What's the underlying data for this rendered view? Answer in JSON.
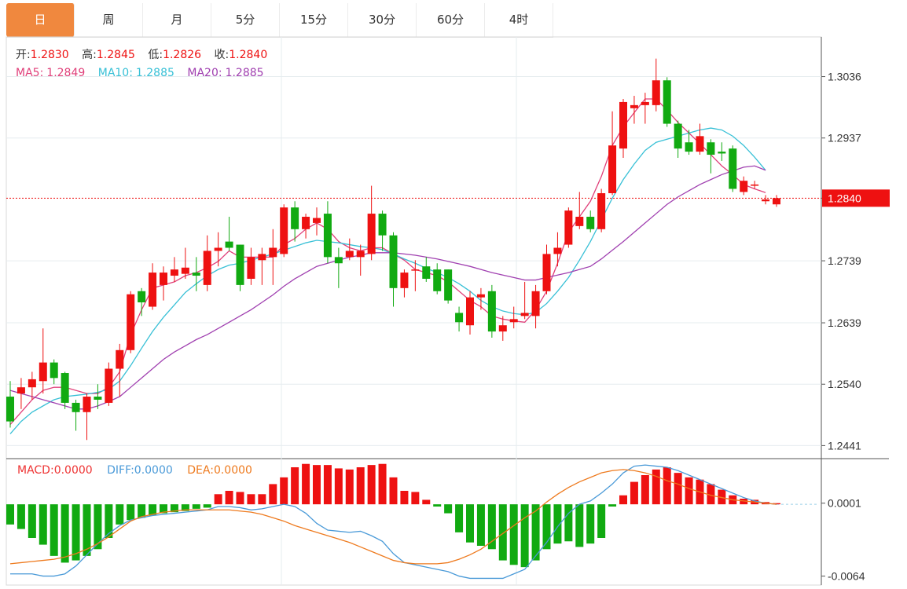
{
  "tabs": [
    {
      "label": "日",
      "active": true
    },
    {
      "label": "周",
      "active": false
    },
    {
      "label": "月",
      "active": false
    },
    {
      "label": "5分",
      "active": false
    },
    {
      "label": "15分",
      "active": false
    },
    {
      "label": "30分",
      "active": false
    },
    {
      "label": "60分",
      "active": false
    },
    {
      "label": "4时",
      "active": false
    }
  ],
  "ohlc_header": {
    "open_label": "开:",
    "open": "1.2830",
    "high_label": "高:",
    "high": "1.2845",
    "low_label": "低:",
    "low": "1.2826",
    "close_label": "收:",
    "close": "1.2840"
  },
  "ma_header": {
    "ma5_label": "MA5:",
    "ma5": "1.2849",
    "ma10_label": "MA10:",
    "ma10": "1.2885",
    "ma20_label": "MA20:",
    "ma20": "1.2885"
  },
  "macd_header": {
    "macd_label": "MACD:",
    "macd": "0.0000",
    "diff_label": "DIFF:",
    "diff": "0.0000",
    "dea_label": "DEA:",
    "dea": "0.0000"
  },
  "colors": {
    "up": "#ee1111",
    "down": "#11aa11",
    "ma5": "#e0407a",
    "ma10": "#38c0d6",
    "ma20": "#a040b0",
    "diff": "#4a9ad8",
    "dea": "#ee7a1e",
    "last": "#ee1111"
  },
  "chart_data": [
    {
      "type": "candlestick",
      "ylim": [
        1.242,
        1.31
      ],
      "yticks": [
        "1.3036",
        "1.2937",
        "1.2840",
        "1.2739",
        "1.2639",
        "1.2540",
        "1.2441"
      ],
      "last_price": "1.2840",
      "candles": [
        [
          1.252,
          1.248,
          1.2545,
          1.247
        ],
        [
          1.2525,
          1.2535,
          1.255,
          1.25
        ],
        [
          1.2535,
          1.2548,
          1.256,
          1.2515
        ],
        [
          1.2545,
          1.2575,
          1.263,
          1.2525
        ],
        [
          1.2575,
          1.255,
          1.258,
          1.254
        ],
        [
          1.2558,
          1.251,
          1.256,
          1.25
        ],
        [
          1.251,
          1.2495,
          1.2515,
          1.2465
        ],
        [
          1.2495,
          1.252,
          1.2525,
          1.245
        ],
        [
          1.252,
          1.2515,
          1.254,
          1.25
        ],
        [
          1.251,
          1.2565,
          1.2575,
          1.2505
        ],
        [
          1.2565,
          1.2595,
          1.2605,
          1.252
        ],
        [
          1.2595,
          1.2685,
          1.269,
          1.259
        ],
        [
          1.269,
          1.2672,
          1.2695,
          1.265
        ],
        [
          1.2665,
          1.272,
          1.2735,
          1.266
        ],
        [
          1.27,
          1.272,
          1.273,
          1.2675
        ],
        [
          1.2715,
          1.2725,
          1.2745,
          1.2705
        ],
        [
          1.2718,
          1.2728,
          1.276,
          1.271
        ],
        [
          1.272,
          1.2715,
          1.2745,
          1.269
        ],
        [
          1.27,
          1.2755,
          1.278,
          1.269
        ],
        [
          1.2755,
          1.276,
          1.2785,
          1.273
        ],
        [
          1.277,
          1.276,
          1.281,
          1.2755
        ],
        [
          1.2765,
          1.27,
          1.2765,
          1.269
        ],
        [
          1.271,
          1.2745,
          1.276,
          1.27
        ],
        [
          1.274,
          1.275,
          1.276,
          1.27
        ],
        [
          1.2745,
          1.276,
          1.279,
          1.27
        ],
        [
          1.275,
          1.2825,
          1.283,
          1.2745
        ],
        [
          1.2825,
          1.279,
          1.2835,
          1.277
        ],
        [
          1.279,
          1.281,
          1.2815,
          1.2775
        ],
        [
          1.28,
          1.2808,
          1.2825,
          1.278
        ],
        [
          1.2815,
          1.2745,
          1.2835,
          1.2735
        ],
        [
          1.2745,
          1.2735,
          1.276,
          1.2695
        ],
        [
          1.2745,
          1.2755,
          1.2775,
          1.274
        ],
        [
          1.2745,
          1.2755,
          1.2765,
          1.2715
        ],
        [
          1.275,
          1.2815,
          1.286,
          1.274
        ],
        [
          1.2815,
          1.278,
          1.282,
          1.2755
        ],
        [
          1.278,
          1.2695,
          1.2785,
          1.2665
        ],
        [
          1.2695,
          1.272,
          1.2725,
          1.268
        ],
        [
          1.2725,
          1.2725,
          1.274,
          1.269
        ],
        [
          1.273,
          1.271,
          1.2745,
          1.2705
        ],
        [
          1.2725,
          1.269,
          1.2735,
          1.2685
        ],
        [
          1.2725,
          1.2675,
          1.2725,
          1.267
        ],
        [
          1.2655,
          1.264,
          1.2665,
          1.2625
        ],
        [
          1.2635,
          1.268,
          1.269,
          1.262
        ],
        [
          1.268,
          1.2685,
          1.2695,
          1.266
        ],
        [
          1.269,
          1.2625,
          1.27,
          1.2615
        ],
        [
          1.2625,
          1.2635,
          1.265,
          1.261
        ],
        [
          1.264,
          1.2645,
          1.2665,
          1.263
        ],
        [
          1.265,
          1.2655,
          1.2705,
          1.2645
        ],
        [
          1.265,
          1.269,
          1.27,
          1.263
        ],
        [
          1.269,
          1.275,
          1.2765,
          1.2685
        ],
        [
          1.275,
          1.276,
          1.2785,
          1.273
        ],
        [
          1.2765,
          1.282,
          1.2825,
          1.276
        ],
        [
          1.2795,
          1.281,
          1.285,
          1.279
        ],
        [
          1.281,
          1.279,
          1.282,
          1.2785
        ],
        [
          1.279,
          1.2848,
          1.2855,
          1.2785
        ],
        [
          1.2848,
          1.2925,
          1.298,
          1.2845
        ],
        [
          1.292,
          1.2995,
          1.3,
          1.2905
        ],
        [
          1.2985,
          1.299,
          1.3005,
          1.296
        ],
        [
          1.299,
          1.2995,
          1.301,
          1.296
        ],
        [
          1.299,
          1.303,
          1.3065,
          1.298
        ],
        [
          1.303,
          1.296,
          1.3035,
          1.2955
        ],
        [
          1.296,
          1.292,
          1.2965,
          1.2905
        ],
        [
          1.293,
          1.2915,
          1.295,
          1.291
        ],
        [
          1.2915,
          1.294,
          1.296,
          1.291
        ],
        [
          1.293,
          1.291,
          1.2935,
          1.288
        ],
        [
          1.2915,
          1.2912,
          1.293,
          1.29
        ],
        [
          1.292,
          1.2855,
          1.2925,
          1.285
        ],
        [
          1.285,
          1.2868,
          1.2875,
          1.2845
        ],
        [
          1.286,
          1.2862,
          1.2868,
          1.2855
        ],
        [
          1.2835,
          1.2838,
          1.2845,
          1.283
        ],
        [
          1.283,
          1.284,
          1.2845,
          1.2826
        ]
      ],
      "ma5": [
        1.2475,
        1.2495,
        1.2515,
        1.253,
        1.2535,
        1.2535,
        1.253,
        1.2525,
        1.2525,
        1.2535,
        1.256,
        1.262,
        1.266,
        1.2695,
        1.27,
        1.2705,
        1.2715,
        1.272,
        1.2728,
        1.2738,
        1.2755,
        1.2745,
        1.2745,
        1.2745,
        1.2745,
        1.2765,
        1.2775,
        1.279,
        1.28,
        1.279,
        1.277,
        1.276,
        1.2755,
        1.276,
        1.276,
        1.275,
        1.274,
        1.2725,
        1.272,
        1.2715,
        1.2705,
        1.269,
        1.2675,
        1.2665,
        1.265,
        1.2645,
        1.2642,
        1.264,
        1.266,
        1.269,
        1.2735,
        1.2785,
        1.281,
        1.2835,
        1.2875,
        1.2925,
        1.2955,
        1.2978,
        1.3,
        1.3,
        1.2982,
        1.2962,
        1.2945,
        1.2928,
        1.291,
        1.2892,
        1.2878,
        1.2862,
        1.2855,
        1.2849
      ],
      "ma10": [
        1.246,
        1.248,
        1.2495,
        1.2505,
        1.2515,
        1.252,
        1.2522,
        1.2524,
        1.2527,
        1.2532,
        1.2545,
        1.257,
        1.2598,
        1.2625,
        1.2648,
        1.2668,
        1.2688,
        1.2702,
        1.2715,
        1.2725,
        1.2732,
        1.2735,
        1.274,
        1.2745,
        1.275,
        1.2756,
        1.2762,
        1.2768,
        1.2772,
        1.277,
        1.2768,
        1.2765,
        1.2762,
        1.276,
        1.2757,
        1.275,
        1.2742,
        1.2735,
        1.2727,
        1.272,
        1.2712,
        1.2702,
        1.269,
        1.2675,
        1.2665,
        1.2658,
        1.2654,
        1.2652,
        1.2656,
        1.267,
        1.269,
        1.2712,
        1.274,
        1.277,
        1.2805,
        1.284,
        1.287,
        1.2895,
        1.2917,
        1.293,
        1.2935,
        1.294,
        1.2945,
        1.295,
        1.2953,
        1.295,
        1.294,
        1.2925,
        1.2906,
        1.2885
      ],
      "ma20": [
        1.253,
        1.2525,
        1.252,
        1.2515,
        1.251,
        1.2505,
        1.25,
        1.25,
        1.2505,
        1.2512,
        1.252,
        1.2535,
        1.255,
        1.2565,
        1.258,
        1.2592,
        1.2602,
        1.2612,
        1.262,
        1.263,
        1.264,
        1.265,
        1.266,
        1.2672,
        1.2684,
        1.2698,
        1.271,
        1.272,
        1.273,
        1.2735,
        1.274,
        1.2745,
        1.2748,
        1.2752,
        1.2752,
        1.2752,
        1.275,
        1.2748,
        1.2745,
        1.2742,
        1.2738,
        1.2734,
        1.273,
        1.2725,
        1.272,
        1.2716,
        1.2712,
        1.2708,
        1.2708,
        1.2712,
        1.2716,
        1.272,
        1.2725,
        1.273,
        1.2742,
        1.2756,
        1.277,
        1.2785,
        1.28,
        1.2815,
        1.283,
        1.2842,
        1.2852,
        1.2862,
        1.287,
        1.2878,
        1.2884,
        1.289,
        1.2892,
        1.2885
      ]
    },
    {
      "type": "bar",
      "name": "MACD",
      "ylim": [
        -0.0072,
        0.004
      ],
      "yticks": [
        "0.0001",
        "-0.0064"
      ],
      "macd": [
        -0.0018,
        -0.0022,
        -0.003,
        -0.0036,
        -0.0046,
        -0.0052,
        -0.005,
        -0.0046,
        -0.004,
        -0.003,
        -0.0018,
        -0.0014,
        -0.0012,
        -0.001,
        -0.0008,
        -0.0007,
        -0.0006,
        -0.0004,
        -0.0003,
        0.0009,
        0.0012,
        0.0011,
        0.0009,
        0.0009,
        0.0018,
        0.0024,
        0.0033,
        0.0036,
        0.0035,
        0.0035,
        0.0032,
        0.0031,
        0.0033,
        0.0035,
        0.0036,
        0.0024,
        0.0012,
        0.0011,
        0.0004,
        -0.0002,
        -0.0008,
        -0.0025,
        -0.0034,
        -0.0037,
        -0.004,
        -0.005,
        -0.0054,
        -0.0056,
        -0.005,
        -0.004,
        -0.0035,
        -0.0033,
        -0.0038,
        -0.0035,
        -0.003,
        -0.0002,
        0.0008,
        0.002,
        0.0026,
        0.0031,
        0.0033,
        0.0028,
        0.0024,
        0.0022,
        0.0018,
        0.0013,
        0.0008,
        0.0005,
        0.0004,
        0.0002,
        0.0001
      ],
      "diff": [
        -0.0062,
        -0.0062,
        -0.0062,
        -0.0064,
        -0.0064,
        -0.0062,
        -0.0055,
        -0.0045,
        -0.0035,
        -0.0026,
        -0.0019,
        -0.0014,
        -0.0012,
        -0.001,
        -0.0009,
        -0.0008,
        -0.0007,
        -0.0006,
        -0.0005,
        -0.0002,
        -0.0002,
        -0.0003,
        -0.0005,
        -0.0004,
        -0.0002,
        0.0,
        -0.0002,
        -0.0008,
        -0.0017,
        -0.0023,
        -0.0024,
        -0.0025,
        -0.0024,
        -0.0028,
        -0.0033,
        -0.0044,
        -0.0052,
        -0.0054,
        -0.0056,
        -0.0058,
        -0.006,
        -0.0064,
        -0.0066,
        -0.0066,
        -0.0066,
        -0.0066,
        -0.0062,
        -0.0058,
        -0.0046,
        -0.0034,
        -0.002,
        -0.0008,
        0.0,
        0.0003,
        0.001,
        0.0018,
        0.0028,
        0.0034,
        0.0035,
        0.0034,
        0.0033,
        0.003,
        0.0026,
        0.0022,
        0.0018,
        0.0014,
        0.001,
        0.0006,
        0.0003,
        0.0001,
        0.0
      ],
      "dea": [
        -0.0053,
        -0.0052,
        -0.0051,
        -0.005,
        -0.0049,
        -0.0047,
        -0.0044,
        -0.004,
        -0.0035,
        -0.0029,
        -0.0022,
        -0.0015,
        -0.0011,
        -0.0009,
        -0.0007,
        -0.0006,
        -0.0005,
        -0.0005,
        -0.0005,
        -0.0005,
        -0.0005,
        -0.0006,
        -0.0007,
        -0.0009,
        -0.0012,
        -0.0015,
        -0.0019,
        -0.0022,
        -0.0025,
        -0.0028,
        -0.0031,
        -0.0034,
        -0.0038,
        -0.0042,
        -0.0046,
        -0.005,
        -0.0052,
        -0.0053,
        -0.0053,
        -0.0053,
        -0.0052,
        -0.0049,
        -0.0045,
        -0.004,
        -0.0033,
        -0.0026,
        -0.0019,
        -0.0012,
        -0.0006,
        0.0002,
        0.0009,
        0.0015,
        0.002,
        0.0024,
        0.0028,
        0.003,
        0.0031,
        0.003,
        0.0028,
        0.0025,
        0.0021,
        0.0018,
        0.0014,
        0.0011,
        0.0008,
        0.0006,
        0.0004,
        0.0003,
        0.0002,
        0.0001,
        0.0
      ]
    }
  ]
}
